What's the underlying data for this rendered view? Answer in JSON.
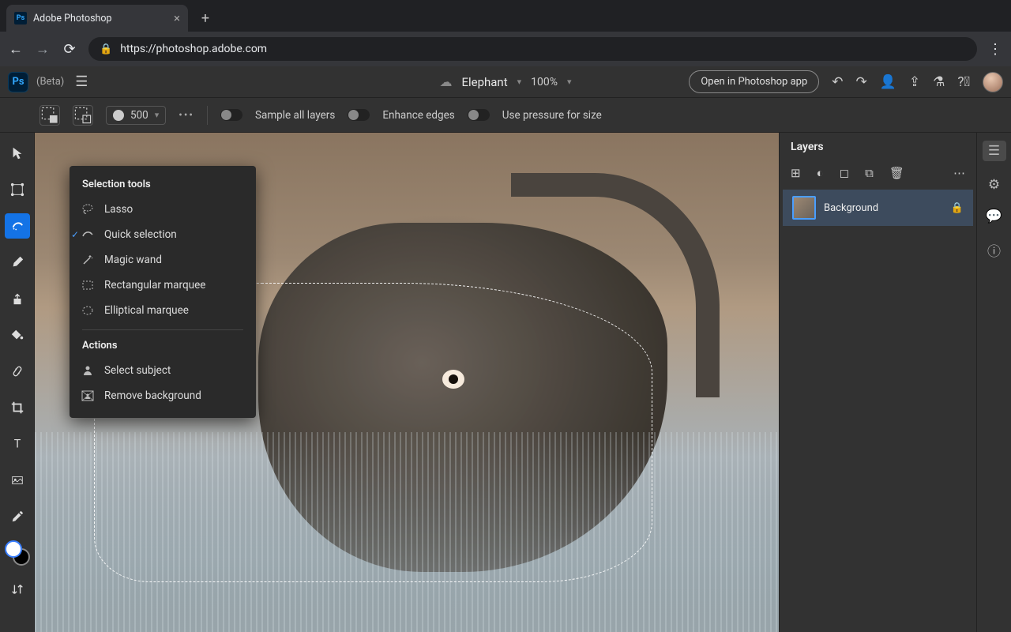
{
  "browser": {
    "tab_title": "Adobe Photoshop",
    "url": "https://photoshop.adobe.com"
  },
  "header": {
    "beta_label": "(Beta)",
    "document_name": "Elephant",
    "zoom": "100%",
    "open_app_label": "Open in Photoshop app"
  },
  "options_bar": {
    "brush_size": "500",
    "sample_all_layers": "Sample all layers",
    "enhance_edges": "Enhance edges",
    "use_pressure": "Use pressure for size"
  },
  "popup": {
    "section1_title": "Selection tools",
    "items": [
      {
        "label": "Lasso",
        "checked": false
      },
      {
        "label": "Quick selection",
        "checked": true
      },
      {
        "label": "Magic wand",
        "checked": false
      },
      {
        "label": "Rectangular marquee",
        "checked": false
      },
      {
        "label": "Elliptical marquee",
        "checked": false
      }
    ],
    "section2_title": "Actions",
    "actions": [
      {
        "label": "Select subject"
      },
      {
        "label": "Remove background"
      }
    ]
  },
  "layers_panel": {
    "title": "Layers",
    "layer_name": "Background"
  }
}
